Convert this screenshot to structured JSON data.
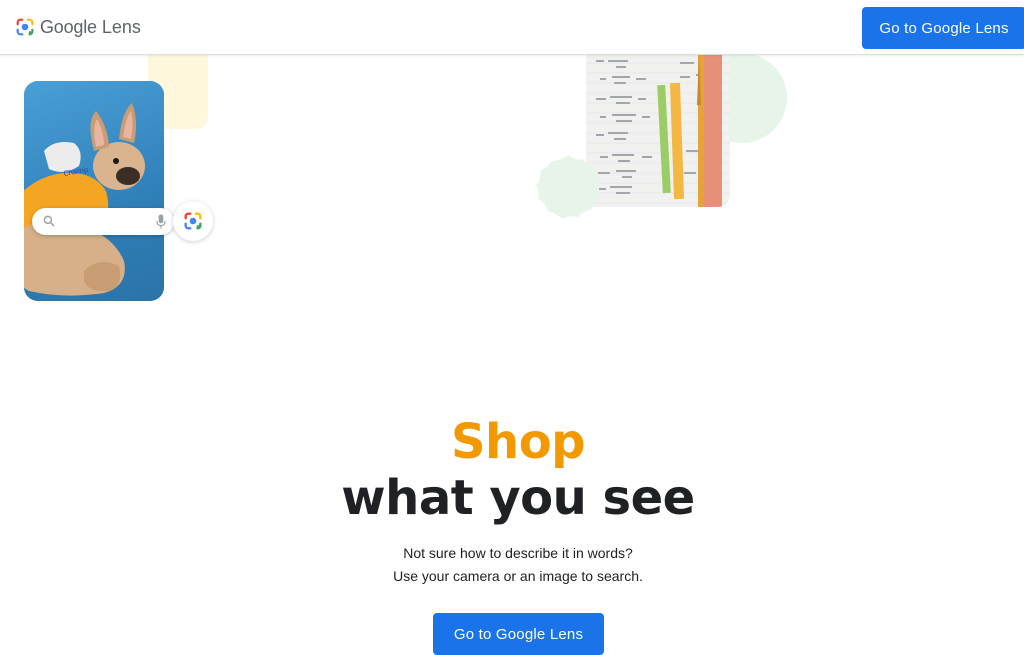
{
  "header": {
    "brand_google": "Google",
    "brand_lens": "Lens",
    "cta_label": "Go to Google Lens"
  },
  "hero": {
    "highlight": "Shop",
    "title": "what you see",
    "description_line1": "Not sure how to describe it in words?",
    "description_line2": "Use your camera or an image to search.",
    "cta_label": "Go to Google Lens"
  },
  "colors": {
    "primary_blue": "#1a73e8",
    "highlight_orange": "#f29900",
    "text_dark": "#202124"
  },
  "icons": [
    "google-lens-logo-icon",
    "search-icon",
    "microphone-icon",
    "google-lens-camera-icon"
  ]
}
